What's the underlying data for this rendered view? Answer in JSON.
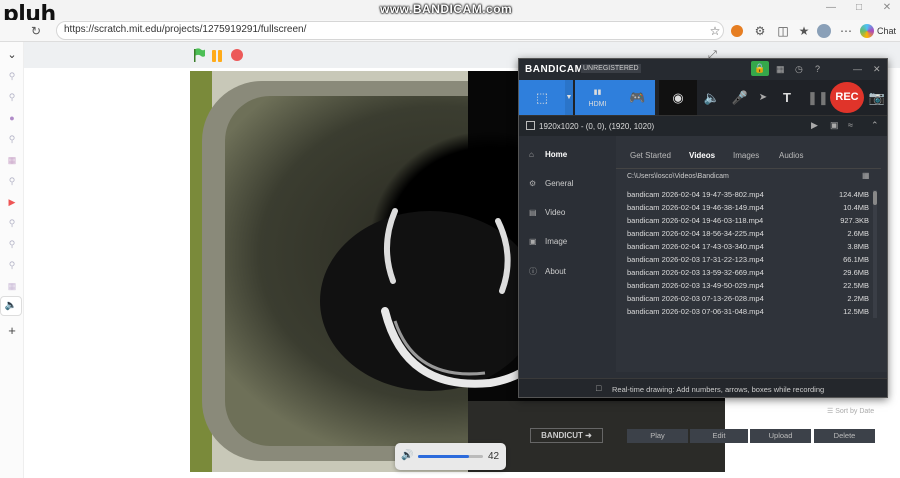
{
  "overlay": {
    "pluh_text": "pluh",
    "watermark": "www.BANDICAM.com"
  },
  "browser": {
    "url": "https://scratch.mit.edu/projects/1275919291/fullscreen/",
    "chat_label": "Chat",
    "icons": [
      "star-icon",
      "extension-orange-icon",
      "puzzle-icon",
      "split-screen-icon",
      "favorites-icon",
      "collections-icon",
      "profile-icon",
      "more-icon",
      "copilot-icon"
    ]
  },
  "sidebar": {
    "icons": [
      "chevron-down-icon",
      "search-icon",
      "search-icon",
      "circle-icon",
      "search-icon",
      "grid-icon",
      "search-icon",
      "youtube-icon",
      "search-icon",
      "search-icon",
      "search-icon",
      "search-icon",
      "grid-icon",
      "speaker-icon",
      "plus-icon"
    ]
  },
  "scratch": {
    "volume": "42",
    "volume_level": 0.78
  },
  "bandicam": {
    "logo": "BANDICAM",
    "unregistered": "UNREGISTERED",
    "rec_label": "REC",
    "toolbar_text": "T",
    "info": "1920x1020 - (0, 0), (1920, 1020)",
    "nav": [
      {
        "label": "Home",
        "icon": "home-icon"
      },
      {
        "label": "General",
        "icon": "gear-icon"
      },
      {
        "label": "Video",
        "icon": "film-icon"
      },
      {
        "label": "Image",
        "icon": "image-icon"
      },
      {
        "label": "About",
        "icon": "info-icon"
      }
    ],
    "bandicut": "BANDICUT",
    "tabs": [
      "Get Started",
      "Videos",
      "Images",
      "Audios"
    ],
    "path": "C:\\Users\\losco\\Videos\\Bandicam",
    "files": [
      {
        "name": "bandicam 2026-02-04 19-47-35-802.mp4",
        "size": "124.4MB"
      },
      {
        "name": "bandicam 2026-02-04 19-46-38-149.mp4",
        "size": "10.4MB"
      },
      {
        "name": "bandicam 2026-02-04 19-46-03-118.mp4",
        "size": "927.3KB"
      },
      {
        "name": "bandicam 2026-02-04 18-56-34-225.mp4",
        "size": "2.6MB"
      },
      {
        "name": "bandicam 2026-02-04 17-43-03-340.mp4",
        "size": "3.8MB"
      },
      {
        "name": "bandicam 2026-02-03 17-31-22-123.mp4",
        "size": "66.1MB"
      },
      {
        "name": "bandicam 2026-02-03 13-59-32-669.mp4",
        "size": "29.6MB"
      },
      {
        "name": "bandicam 2026-02-03 13-49-50-029.mp4",
        "size": "22.5MB"
      },
      {
        "name": "bandicam 2026-02-03 07-13-26-028.mp4",
        "size": "2.2MB"
      },
      {
        "name": "bandicam 2026-02-03 07-06-31-048.mp4",
        "size": "12.5MB"
      }
    ],
    "sort": "Sort by Date",
    "actions": [
      "Play",
      "Edit",
      "Upload",
      "Delete"
    ],
    "status": "Real-time drawing: Add numbers, arrows, boxes while recording"
  }
}
